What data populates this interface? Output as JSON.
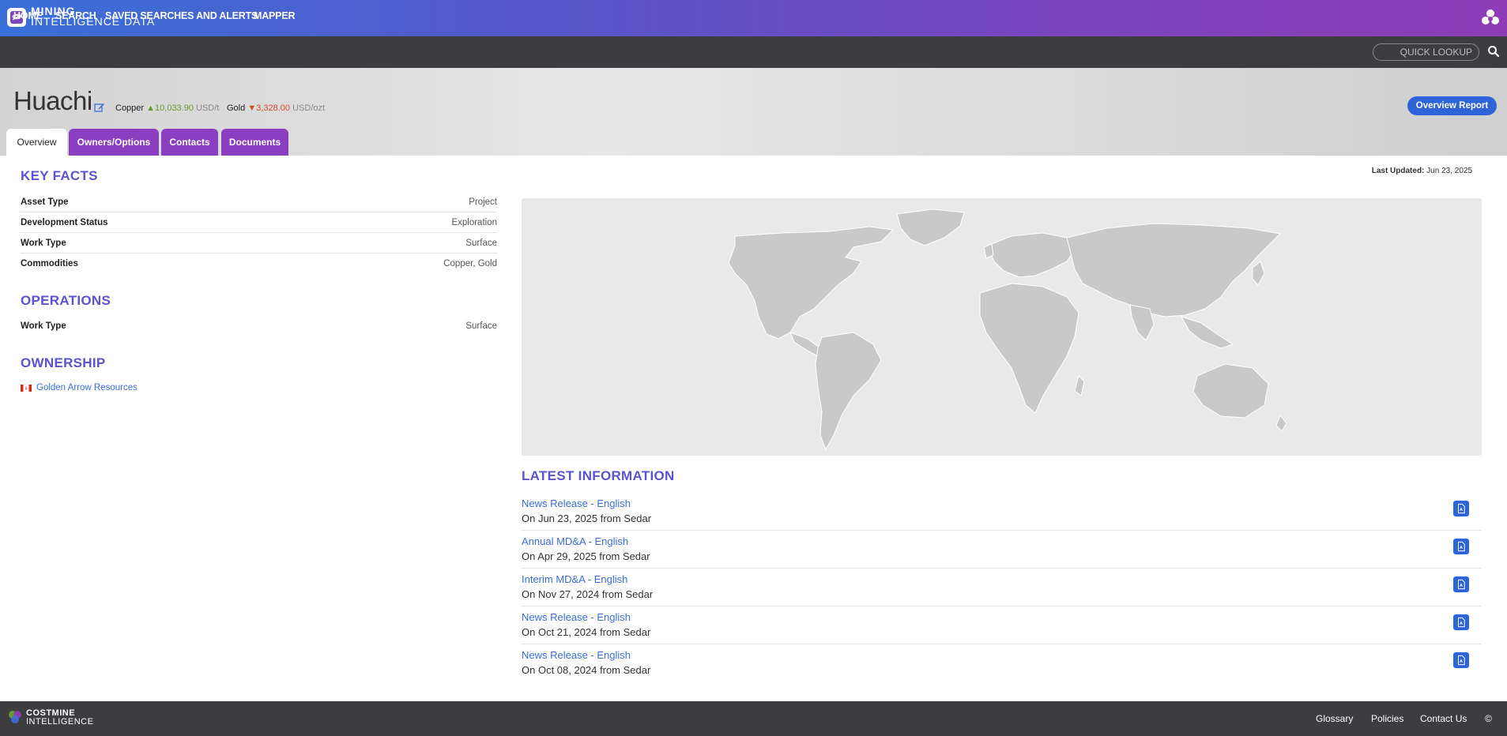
{
  "brand": {
    "line1": "MINING",
    "line2": "INTELLIGENCE DATA"
  },
  "nav": {
    "items": [
      "HOME",
      "SEARCH",
      "SAVED SEARCHES AND ALERTS",
      "MAPPER"
    ],
    "quick_lookup_placeholder": "QUICK LOOKUP",
    "search_icon": "search-icon"
  },
  "header": {
    "title": "Huachi",
    "prices": [
      {
        "name": "Copper",
        "direction": "up",
        "arrow": "▲",
        "value": "10,033.90",
        "unit": "USD/t"
      },
      {
        "name": "Gold",
        "direction": "down",
        "arrow": "▼",
        "value": "3,328.00",
        "unit": "USD/ozt"
      }
    ],
    "overview_report_label": "Overview Report",
    "tabs": [
      "Overview",
      "Owners/Options",
      "Contacts",
      "Documents"
    ],
    "active_tab": "Overview"
  },
  "last_updated": {
    "label": "Last Updated:",
    "value": "Jun 23, 2025"
  },
  "key_facts": {
    "title": "KEY FACTS",
    "rows": [
      {
        "label": "Asset Type",
        "value": "Project"
      },
      {
        "label": "Development Status",
        "value": "Exploration"
      },
      {
        "label": "Work Type",
        "value": "Surface"
      },
      {
        "label": "Commodities",
        "value": "Copper, Gold"
      }
    ]
  },
  "operations": {
    "title": "OPERATIONS",
    "rows": [
      {
        "label": "Work Type",
        "value": "Surface"
      }
    ]
  },
  "ownership": {
    "title": "OWNERSHIP",
    "owners": [
      {
        "name": "Golden Arrow Resources",
        "flag": "canada-flag"
      }
    ]
  },
  "latest_information": {
    "title": "LATEST INFORMATION",
    "items": [
      {
        "title": "News Release - English",
        "meta": "On Jun 23, 2025 from Sedar"
      },
      {
        "title": "Annual MD&A - English",
        "meta": "On Apr 29, 2025 from Sedar"
      },
      {
        "title": "Interim MD&A - English",
        "meta": "On Nov 27, 2024 from Sedar"
      },
      {
        "title": "News Release - English",
        "meta": "On Oct 21, 2024 from Sedar"
      },
      {
        "title": "News Release - English",
        "meta": "On Oct 08, 2024 from Sedar"
      }
    ]
  },
  "footer": {
    "brand_line1": "COSTMINE",
    "brand_line2": "INTELLIGENCE",
    "links": [
      "Glossary",
      "Policies",
      "Contact Us",
      "©"
    ]
  },
  "colors": {
    "accent": "#5b53cf",
    "tab_purple": "#8a3fc0",
    "link_blue": "#3a6fd8",
    "nav_dark": "#3d3c3e"
  }
}
